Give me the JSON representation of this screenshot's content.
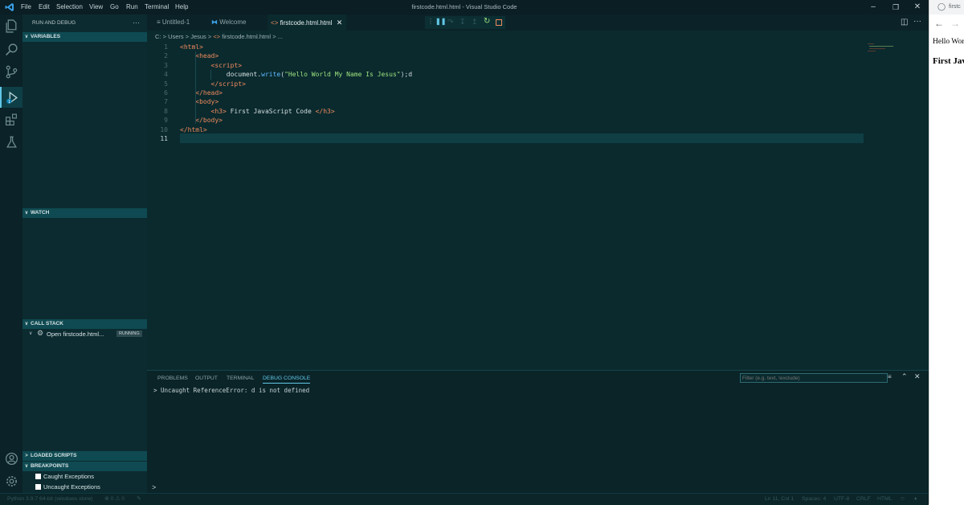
{
  "window": {
    "title": "firstcode.html.html - Visual Studio Code",
    "menu": [
      "File",
      "Edit",
      "Selection",
      "View",
      "Go",
      "Run",
      "Terminal",
      "Help"
    ]
  },
  "sidebar": {
    "title": "RUN AND DEBUG",
    "more": "···",
    "sections": {
      "variables": "VARIABLES",
      "watch": "WATCH",
      "call_stack": "CALL STACK",
      "loaded_scripts": "LOADED SCRIPTS",
      "breakpoints": "BREAKPOINTS"
    },
    "call_stack_item": {
      "label": "Open firstcode.html...",
      "badge": "RUNNING"
    },
    "breakpoints": [
      {
        "label": "Caught Exceptions",
        "checked": false
      },
      {
        "label": "Uncaught Exceptions",
        "checked": false
      }
    ]
  },
  "tabs": [
    {
      "label": "Untitled-1",
      "active": false
    },
    {
      "label": "Welcome",
      "active": false
    },
    {
      "label": "firstcode.html.html",
      "active": true
    }
  ],
  "breadcrumb": [
    "C:",
    "Users",
    "Jesus",
    "firstcode.html.html",
    "..."
  ],
  "code_lines": [
    {
      "n": "1",
      "html": "<span class='tag'>&lt;html&gt;</span>"
    },
    {
      "n": "2",
      "html": "    <span class='tag'>&lt;head&gt;</span>"
    },
    {
      "n": "3",
      "html": "        <span class='tag'>&lt;script&gt;</span>"
    },
    {
      "n": "4",
      "html": "            document.<span class='kw'>write</span>(<span class='str'>\"Hello World My Name Is Jesus\"</span>);d"
    },
    {
      "n": "5",
      "html": "        <span class='tag'>&lt;/script&gt;</span>"
    },
    {
      "n": "6",
      "html": "    <span class='tag'>&lt;/head&gt;</span>"
    },
    {
      "n": "7",
      "html": "    <span class='tag'>&lt;body&gt;</span>"
    },
    {
      "n": "8",
      "html": "        <span class='tag'>&lt;h3&gt;</span> First JavaScript Code <span class='tag'>&lt;/h3&gt;</span>"
    },
    {
      "n": "9",
      "html": "    <span class='tag'>&lt;/body&gt;</span>"
    },
    {
      "n": "10",
      "html": "<span class='tag'>&lt;/html&gt;</span>"
    },
    {
      "n": "11",
      "html": ""
    }
  ],
  "panel": {
    "tabs": [
      "PROBLEMS",
      "OUTPUT",
      "TERMINAL",
      "DEBUG CONSOLE"
    ],
    "active_tab": "DEBUG CONSOLE",
    "filter_placeholder": "Filter (e.g. text, !exclude)",
    "console_output": "Uncaught ReferenceError: d is not defined",
    "prompt": ">"
  },
  "statusbar": {
    "python": "Python 3.9.7 64-bit (windows store)",
    "problems": "⊗ 0 ⚠ 0",
    "position": "Ln 11, Col 1",
    "spaces": "Spaces: 4",
    "encoding": "UTF-8",
    "eol": "CRLF",
    "language": "HTML"
  },
  "browser": {
    "tab_title": "firstc",
    "body_text": "Hello Wor",
    "heading": "First Jav"
  },
  "colors": {
    "accent": "#61c6e6",
    "tag": "#f08a5d",
    "string": "#9ee37d",
    "section_header": "#0f4a52"
  }
}
